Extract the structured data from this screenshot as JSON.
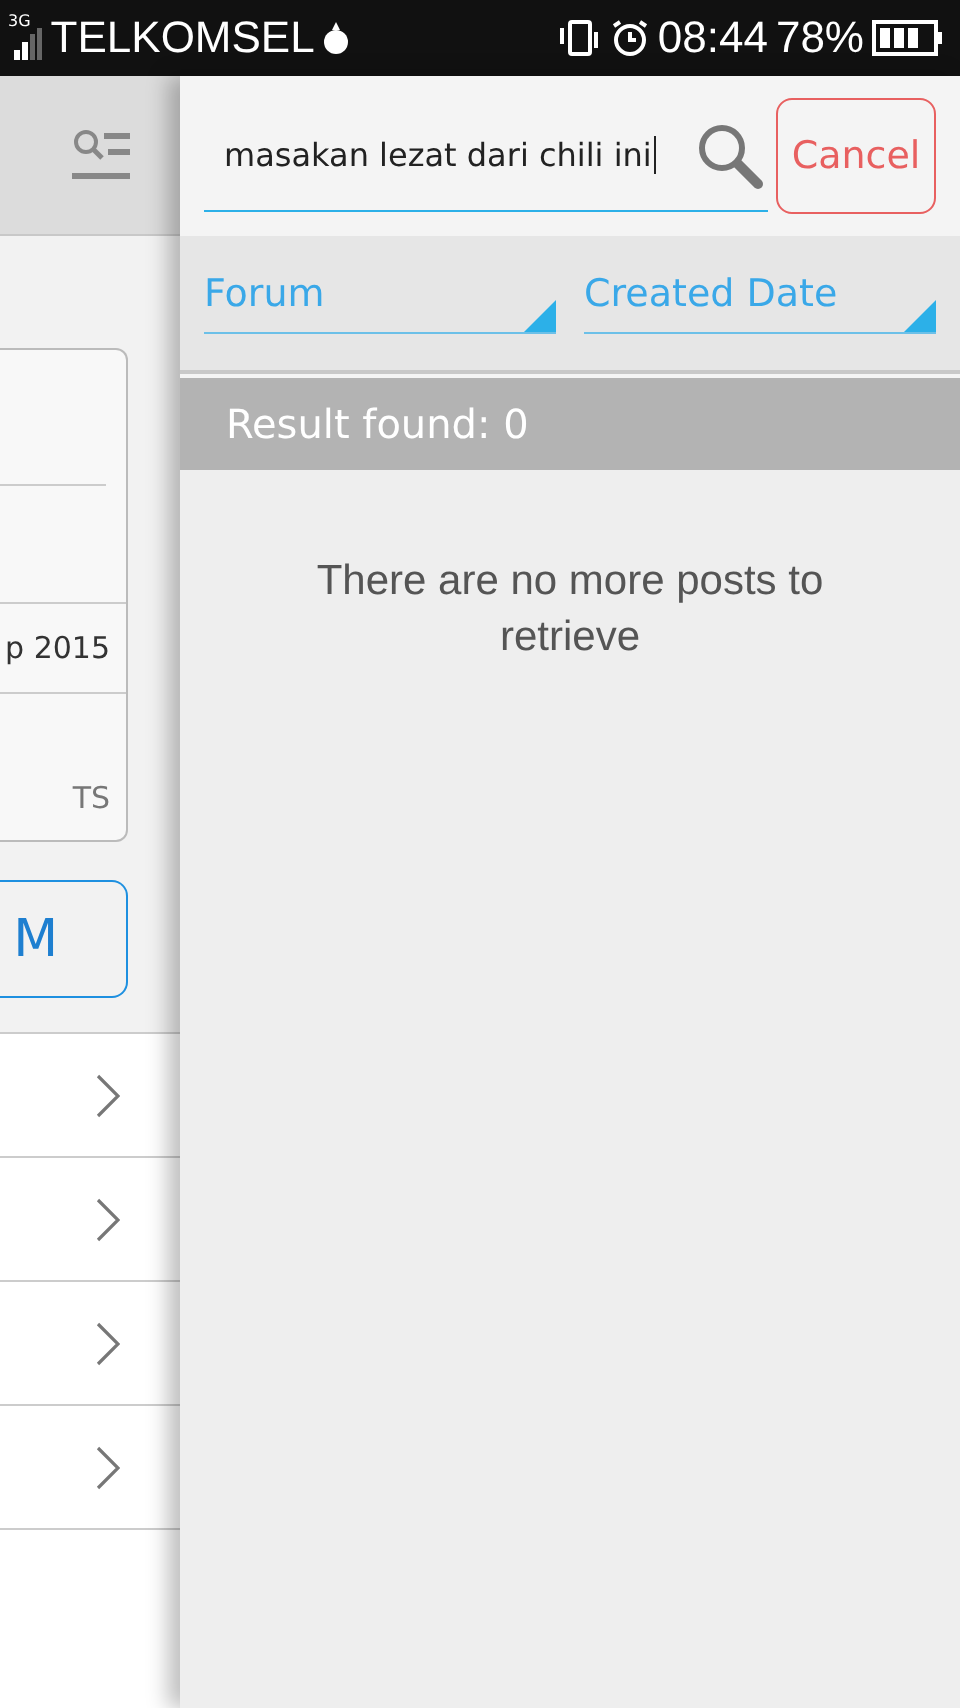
{
  "status_bar": {
    "network": "3G",
    "carrier": "TELKOMSEL",
    "time": "08:44",
    "battery": "78%"
  },
  "side_panel": {
    "card_texts": [
      "p 2015",
      "TS"
    ],
    "button": "M",
    "rows": [
      {
        "kind": "link"
      },
      {
        "kind": "link"
      },
      {
        "kind": "link"
      },
      {
        "kind": "link"
      }
    ]
  },
  "search": {
    "value": "masakan lezat dari chili ini",
    "cancel": "Cancel"
  },
  "filters": [
    {
      "label": "Forum"
    },
    {
      "label": "Created Date"
    }
  ],
  "result_bar": "Result found: 0",
  "message": "There are no more posts to retrieve"
}
